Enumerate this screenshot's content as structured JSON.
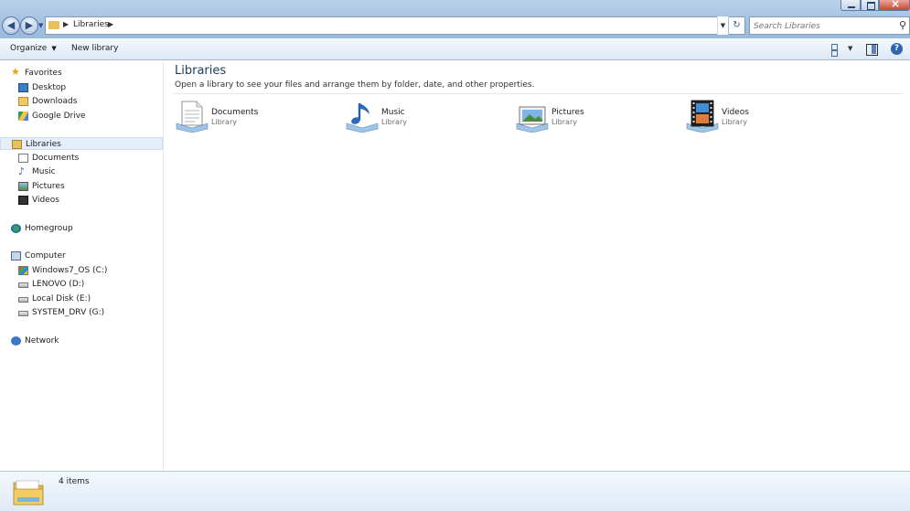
{
  "address": {
    "crumbs": [
      "Libraries"
    ],
    "search_placeholder": "Search Libraries"
  },
  "toolbar": {
    "organize_label": "Organize",
    "new_library_label": "New library"
  },
  "sidebar": {
    "favorites": {
      "label": "Favorites",
      "items": [
        {
          "label": "Desktop",
          "icon": "desktop-icon"
        },
        {
          "label": "Downloads",
          "icon": "downloads-icon"
        },
        {
          "label": "Google Drive",
          "icon": "google-drive-icon"
        }
      ]
    },
    "libraries": {
      "label": "Libraries",
      "selected": true,
      "items": [
        {
          "label": "Documents",
          "icon": "documents-icon"
        },
        {
          "label": "Music",
          "icon": "music-icon"
        },
        {
          "label": "Pictures",
          "icon": "pictures-icon"
        },
        {
          "label": "Videos",
          "icon": "videos-icon"
        }
      ]
    },
    "homegroup": {
      "label": "Homegroup"
    },
    "computer": {
      "label": "Computer",
      "items": [
        {
          "label": "Windows7_OS (C:)",
          "icon": "os-drive-icon"
        },
        {
          "label": "LENOVO (D:)",
          "icon": "drive-icon"
        },
        {
          "label": "Local Disk (E:)",
          "icon": "drive-icon"
        },
        {
          "label": "SYSTEM_DRV (G:)",
          "icon": "drive-icon"
        }
      ]
    },
    "network": {
      "label": "Network"
    }
  },
  "main": {
    "title": "Libraries",
    "description": "Open a library to see your files and arrange them by folder, date, and other properties.",
    "libraries": [
      {
        "name": "Documents",
        "type": "Library",
        "icon": "documents-library-icon"
      },
      {
        "name": "Music",
        "type": "Library",
        "icon": "music-library-icon"
      },
      {
        "name": "Pictures",
        "type": "Library",
        "icon": "pictures-library-icon"
      },
      {
        "name": "Videos",
        "type": "Library",
        "icon": "videos-library-icon"
      }
    ]
  },
  "status": {
    "item_count": "4 items"
  }
}
